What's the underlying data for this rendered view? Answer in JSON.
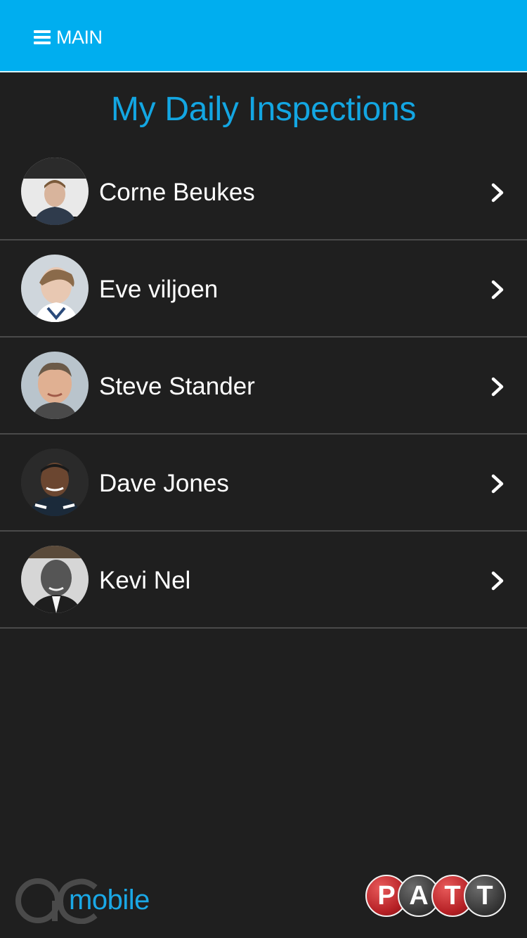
{
  "header": {
    "menu_label": "MAIN",
    "background_color": "#00aeef"
  },
  "page": {
    "title": "My Daily Inspections",
    "title_color": "#13a6e2"
  },
  "inspectors": [
    {
      "name": "Corne Beukes",
      "avatar": "avatar-photo"
    },
    {
      "name": "Eve viljoen",
      "avatar": "avatar-photo"
    },
    {
      "name": "Steve Stander",
      "avatar": "avatar-photo"
    },
    {
      "name": "Dave Jones",
      "avatar": "avatar-photo"
    },
    {
      "name": "Kevi Nel",
      "avatar": "avatar-photo"
    }
  ],
  "footer": {
    "left_logo_text": "mobile",
    "right_logo_letters": [
      "P",
      "A",
      "T",
      "T"
    ]
  },
  "icons": {
    "menu": "hamburger-menu-icon",
    "row_arrow": "chevron-right-icon"
  }
}
